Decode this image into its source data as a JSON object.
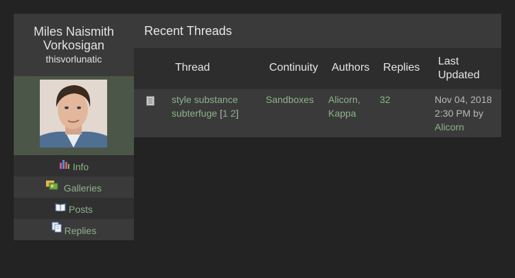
{
  "profile": {
    "full_name": "Miles Naismith Vorkosigan",
    "username": "thisvorlunatic"
  },
  "sidebar": {
    "items": [
      {
        "label": "Info",
        "icon": "chart-icon"
      },
      {
        "label": "Galleries",
        "icon": "gallery-icon"
      },
      {
        "label": "Posts",
        "icon": "book-icon"
      },
      {
        "label": "Replies",
        "icon": "pages-icon"
      }
    ]
  },
  "main": {
    "title": "Recent Threads",
    "columns": {
      "thread": "Thread",
      "continuity": "Continuity",
      "authors": "Authors",
      "replies": "Replies",
      "last_updated_1": "Last",
      "last_updated_2": "Updated"
    },
    "rows": [
      {
        "thread_title": "style substance subterfuge",
        "page_open": "[",
        "page_1": "1",
        "page_2": "2",
        "page_close": "]",
        "continuity": "Sandboxes",
        "author_1": "Alicorn,",
        "author_2": "Kappa",
        "replies": "32",
        "date": "Nov 04, 2018",
        "time_by": "2:30 PM by",
        "last_author": "Alicorn"
      }
    ]
  },
  "colors": {
    "background": "#232323",
    "panel": "#3a3a3a",
    "link": "#8fb28b",
    "avatar_bg": "#4c5648"
  }
}
